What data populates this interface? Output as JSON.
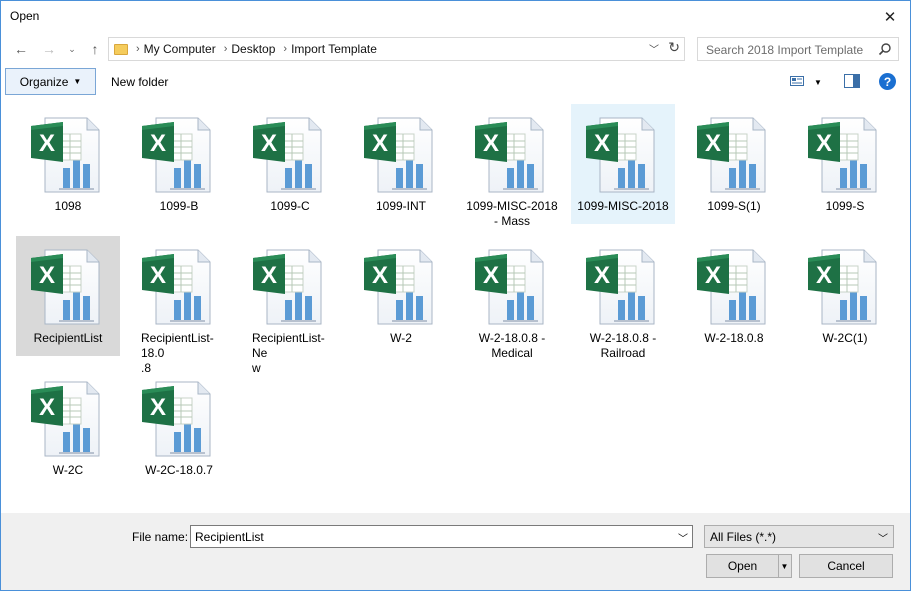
{
  "window": {
    "title": "Open"
  },
  "address": {
    "crumbs": [
      "My Computer",
      "Desktop",
      "Import Template"
    ]
  },
  "search": {
    "placeholder": "Search 2018 Import Template"
  },
  "toolbar": {
    "organize_label": "Organize",
    "new_folder_label": "New folder"
  },
  "files": [
    {
      "name": "1098",
      "state": "normal"
    },
    {
      "name": "1099-B",
      "state": "normal"
    },
    {
      "name": "1099-C",
      "state": "normal"
    },
    {
      "name": "1099-INT",
      "state": "normal"
    },
    {
      "name": "1099-MISC-2018\n- Mass",
      "state": "normal"
    },
    {
      "name": "1099-MISC-2018",
      "state": "hover"
    },
    {
      "name": "1099-S(1)",
      "state": "normal"
    },
    {
      "name": "1099-S",
      "state": "normal"
    },
    {
      "name": "RecipientList",
      "state": "selected"
    },
    {
      "name": "RecipientList-18.0\n.8",
      "state": "normal"
    },
    {
      "name": "RecipientList-Ne\nw",
      "state": "normal"
    },
    {
      "name": "W-2",
      "state": "normal"
    },
    {
      "name": "W-2-18.0.8 -\nMedical",
      "state": "normal"
    },
    {
      "name": "W-2-18.0.8 -\nRailroad",
      "state": "normal"
    },
    {
      "name": "W-2-18.0.8",
      "state": "normal"
    },
    {
      "name": "W-2C(1)",
      "state": "normal"
    },
    {
      "name": "W-2C",
      "state": "normal"
    },
    {
      "name": "W-2C-18.0.7",
      "state": "normal"
    }
  ],
  "bottom": {
    "file_name_label": "File name:",
    "file_name_value": "RecipientList",
    "file_type_value": "All Files (*.*)",
    "open_label": "Open",
    "cancel_label": "Cancel"
  },
  "colors": {
    "accent": "#1a6fd1",
    "excel_green": "#1e7145",
    "selection": "#d9d9d9",
    "hover": "#e5f3fb"
  }
}
